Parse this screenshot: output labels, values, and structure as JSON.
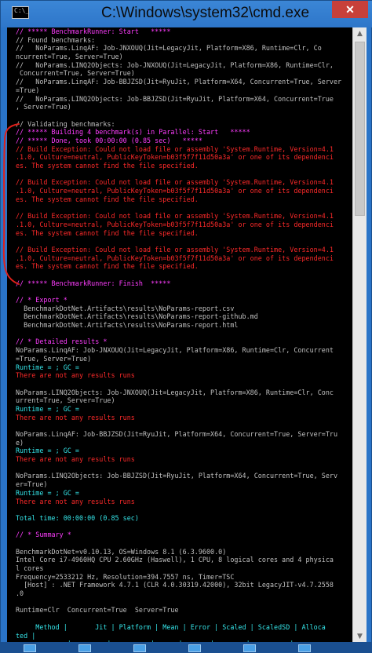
{
  "window": {
    "title": "C:\\Windows\\system32\\cmd.exe",
    "icon_text": "C:\\_",
    "close_label": "✕"
  },
  "console": {
    "lines": [
      {
        "text": "// ***** BenchmarkRunner: Start   *****",
        "color": "magenta"
      },
      {
        "text": "// Found benchmarks:",
        "color": "gray"
      },
      {
        "text": "//   NoParams.LinqAF: Job-JNXOUQ(Jit=LegacyJit, Platform=X86, Runtime=Clr, Co",
        "color": "gray"
      },
      {
        "text": "ncurrent=True, Server=True)",
        "color": "gray"
      },
      {
        "text": "//   NoParams.LINQ2Objects: Job-JNXOUQ(Jit=LegacyJit, Platform=X86, Runtime=Clr,",
        "color": "gray"
      },
      {
        "text": " Concurrent=True, Server=True)",
        "color": "gray"
      },
      {
        "text": "//   NoParams.LinqAF: Job-BBJZSD(Jit=RyuJit, Platform=X64, Concurrent=True, Server",
        "color": "gray"
      },
      {
        "text": "=True)",
        "color": "gray"
      },
      {
        "text": "//   NoParams.LINQ2Objects: Job-BBJZSD(Jit=RyuJit, Platform=X64, Concurrent=True",
        "color": "gray"
      },
      {
        "text": ", Server=True)",
        "color": "gray"
      },
      {
        "text": "",
        "color": "gray"
      },
      {
        "text": "// Validating benchmarks:",
        "color": "gray"
      },
      {
        "text": "// ***** Building 4 benchmark(s) in Parallel: Start   *****",
        "color": "magenta"
      },
      {
        "text": "// ***** Done, took 00:00:00 (0.85 sec)   *****",
        "color": "magenta"
      },
      {
        "text": "// Build Exception: Could not load file or assembly 'System.Runtime, Version=4.1",
        "color": "red"
      },
      {
        "text": ".1.0, Culture=neutral, PublicKeyToken=b03f5f7f11d50a3a' or one of its dependenci",
        "color": "red"
      },
      {
        "text": "es. The system cannot find the file specified.",
        "color": "red"
      },
      {
        "text": "",
        "color": "gray"
      },
      {
        "text": "// Build Exception: Could not load file or assembly 'System.Runtime, Version=4.1",
        "color": "red"
      },
      {
        "text": ".1.0, Culture=neutral, PublicKeyToken=b03f5f7f11d50a3a' or one of its dependenci",
        "color": "red"
      },
      {
        "text": "es. The system cannot find the file specified.",
        "color": "red"
      },
      {
        "text": "",
        "color": "gray"
      },
      {
        "text": "// Build Exception: Could not load file or assembly 'System.Runtime, Version=4.1",
        "color": "red"
      },
      {
        "text": ".1.0, Culture=neutral, PublicKeyToken=b03f5f7f11d50a3a' or one of its dependenci",
        "color": "red"
      },
      {
        "text": "es. The system cannot find the file specified.",
        "color": "red"
      },
      {
        "text": "",
        "color": "gray"
      },
      {
        "text": "// Build Exception: Could not load file or assembly 'System.Runtime, Version=4.1",
        "color": "red"
      },
      {
        "text": ".1.0, Culture=neutral, PublicKeyToken=b03f5f7f11d50a3a' or one of its dependenci",
        "color": "red"
      },
      {
        "text": "es. The system cannot find the file specified.",
        "color": "red"
      },
      {
        "text": "",
        "color": "gray"
      },
      {
        "text": "// ***** BenchmarkRunner: Finish  *****",
        "color": "magenta"
      },
      {
        "text": "",
        "color": "gray"
      },
      {
        "text": "// * Export *",
        "color": "magenta"
      },
      {
        "text": "  BenchmarkDotNet.Artifacts\\results\\NoParams-report.csv",
        "color": "gray"
      },
      {
        "text": "  BenchmarkDotNet.Artifacts\\results\\NoParams-report-github.md",
        "color": "gray"
      },
      {
        "text": "  BenchmarkDotNet.Artifacts\\results\\NoParams-report.html",
        "color": "gray"
      },
      {
        "text": "",
        "color": "gray"
      },
      {
        "text": "// * Detailed results *",
        "color": "magenta"
      },
      {
        "text": "NoParams.LinqAF: Job-JNXOUQ(Jit=LegacyJit, Platform=X86, Runtime=Clr, Concurrent",
        "color": "gray"
      },
      {
        "text": "=True, Server=True)",
        "color": "gray"
      },
      {
        "text": "Runtime = ; GC = ",
        "color": "cyan"
      },
      {
        "text": "There are not any results runs",
        "color": "red"
      },
      {
        "text": "",
        "color": "gray"
      },
      {
        "text": "NoParams.LINQ2Objects: Job-JNXOUQ(Jit=LegacyJit, Platform=X86, Runtime=Clr, Conc",
        "color": "gray"
      },
      {
        "text": "urrent=True, Server=True)",
        "color": "gray"
      },
      {
        "text": "Runtime = ; GC = ",
        "color": "cyan"
      },
      {
        "text": "There are not any results runs",
        "color": "red"
      },
      {
        "text": "",
        "color": "gray"
      },
      {
        "text": "NoParams.LinqAF: Job-BBJZSD(Jit=RyuJit, Platform=X64, Concurrent=True, Server=Tru",
        "color": "gray"
      },
      {
        "text": "e)",
        "color": "gray"
      },
      {
        "text": "Runtime = ; GC = ",
        "color": "cyan"
      },
      {
        "text": "There are not any results runs",
        "color": "red"
      },
      {
        "text": "",
        "color": "gray"
      },
      {
        "text": "NoParams.LINQ2Objects: Job-BBJZSD(Jit=RyuJit, Platform=X64, Concurrent=True, Serv",
        "color": "gray"
      },
      {
        "text": "er=True)",
        "color": "gray"
      },
      {
        "text": "Runtime = ; GC = ",
        "color": "cyan"
      },
      {
        "text": "There are not any results runs",
        "color": "red"
      },
      {
        "text": "",
        "color": "gray"
      },
      {
        "text": "Total time: 00:00:00 (0.85 sec)",
        "color": "cyan"
      },
      {
        "text": "",
        "color": "gray"
      },
      {
        "text": "// * Summary *",
        "color": "magenta"
      },
      {
        "text": "",
        "color": "gray"
      },
      {
        "text": "BenchmarkDotNet=v0.10.13, OS=Windows 8.1 (6.3.9600.0)",
        "color": "gray"
      },
      {
        "text": "Intel Core i7-4960HQ CPU 2.60GHz (Haswell), 1 CPU, 8 logical cores and 4 physica",
        "color": "gray"
      },
      {
        "text": "l cores",
        "color": "gray"
      },
      {
        "text": "Frequency=2533212 Hz, Resolution=394.7557 ns, Timer=TSC",
        "color": "gray"
      },
      {
        "text": "  [Host] : .NET Framework 4.7.1 (CLR 4.0.30319.42000), 32bit LegacyJIT-v4.7.2558",
        "color": "gray"
      },
      {
        "text": ".0",
        "color": "gray"
      },
      {
        "text": "",
        "color": "gray"
      },
      {
        "text": "Runtime=Clr  Concurrent=True  Server=True",
        "color": "gray"
      },
      {
        "text": "",
        "color": "gray"
      },
      {
        "text": "     Method |       Jit | Platform | Mean | Error | Scaled | ScaledSD | Alloca",
        "color": "cyan"
      },
      {
        "text": "ted |",
        "color": "cyan"
      },
      {
        "text": "------------ |-------- |--------- |----- |------ |------- |--------- |-------",
        "color": "cyan"
      }
    ]
  },
  "colors": {
    "gray": "#c0c0c0",
    "magenta": "#ff3dff",
    "red": "#ff2a2a",
    "cyan": "#35e6ea",
    "annotation": "#e0201a"
  },
  "scrollbar": {
    "up_icon": "scroll-up-arrow-icon",
    "down_icon": "scroll-down-arrow-icon"
  }
}
